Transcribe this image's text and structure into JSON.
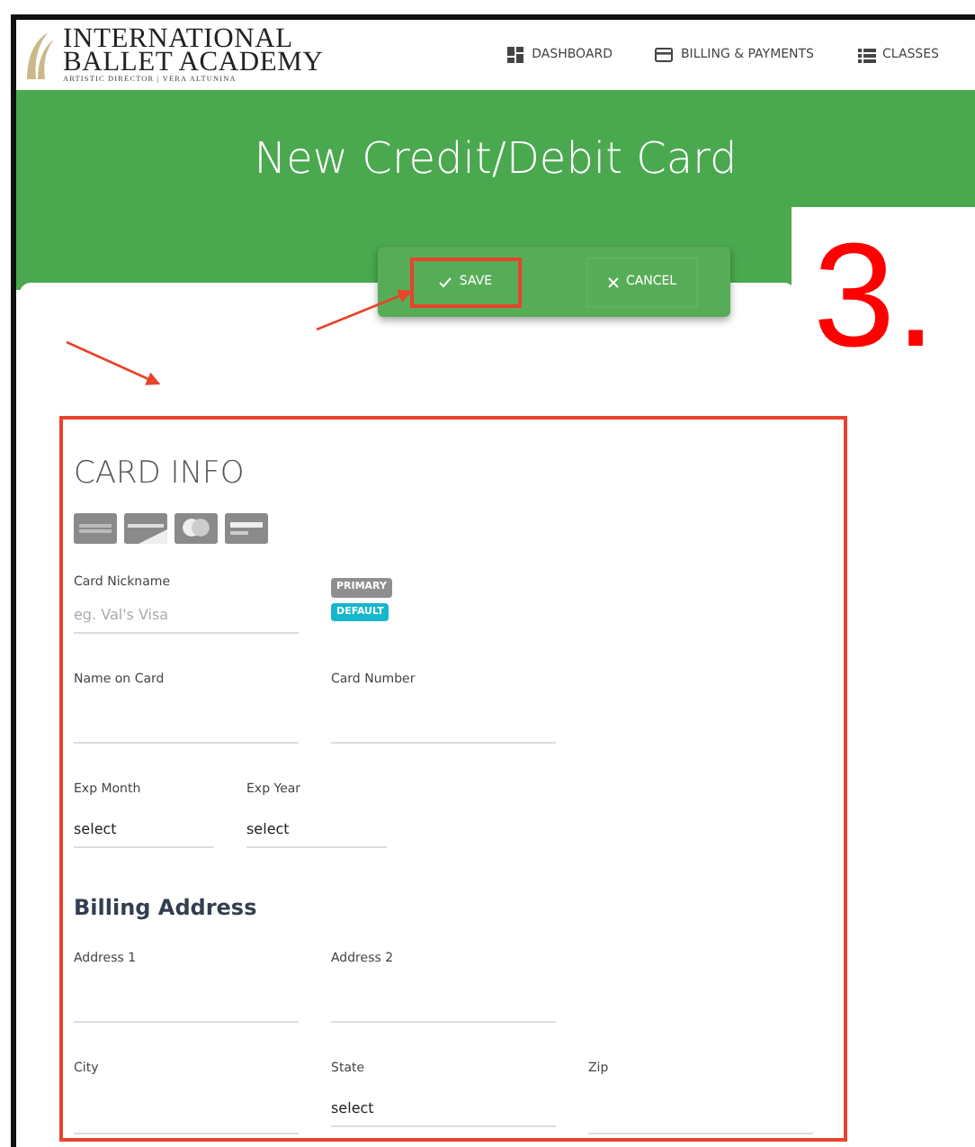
{
  "header": {
    "logo": {
      "line1": "INTERNATIONAL",
      "line2": "BALLET ACADEMY",
      "tagline": "ARTISTIC DIRECTOR | VERA ALTUNINA"
    },
    "nav": [
      {
        "label": "DASHBOARD",
        "kind": "dashboard"
      },
      {
        "label": "BILLING & PAYMENTS",
        "kind": "card"
      },
      {
        "label": "CLASSES",
        "kind": "list"
      }
    ]
  },
  "page_title": "New Credit/Debit Card",
  "actions": [
    {
      "label": "SAVE",
      "kind": "save",
      "highlighted": true
    },
    {
      "label": "CANCEL",
      "kind": "cancel",
      "highlighted": false
    }
  ],
  "annotation": {
    "step": "3."
  },
  "card_info": {
    "title": "CARD INFO",
    "nickname": {
      "label": "Card Nickname",
      "placeholder": "eg. Val's Visa"
    },
    "badges": [
      {
        "label": "PRIMARY",
        "kind": "primary"
      },
      {
        "label": "DEFAULT",
        "kind": "default"
      }
    ],
    "rows": [
      [
        {
          "label": "Name on Card",
          "kind": "text"
        },
        {
          "label": "Card Number",
          "kind": "text"
        }
      ],
      [
        {
          "label": "Exp Month",
          "kind": "select",
          "value": "select"
        },
        {
          "label": "Exp Year",
          "kind": "select",
          "value": "select"
        }
      ]
    ],
    "billing_title": "Billing Address",
    "billing_rows": [
      [
        {
          "label": "Address 1",
          "kind": "text"
        },
        {
          "label": "Address 2",
          "kind": "text"
        }
      ],
      [
        {
          "label": "City",
          "kind": "text"
        },
        {
          "label": "State",
          "kind": "select",
          "value": "select"
        },
        {
          "label": "Zip",
          "kind": "text"
        }
      ]
    ]
  }
}
